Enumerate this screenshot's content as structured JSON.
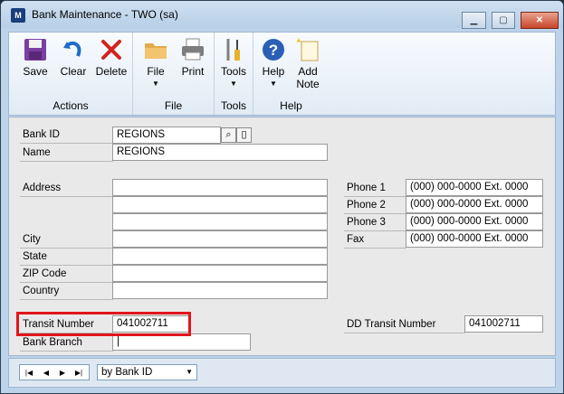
{
  "window": {
    "title": "Bank Maintenance  -  TWO (sa)",
    "app_icon_text": "M"
  },
  "ribbon": {
    "groups": [
      {
        "name": "Actions",
        "buttons": [
          "Save",
          "Clear",
          "Delete"
        ]
      },
      {
        "name": "File",
        "buttons": [
          "File",
          "Print"
        ]
      },
      {
        "name": "Tools",
        "buttons": [
          "Tools"
        ]
      },
      {
        "name": "Help",
        "buttons": [
          "Help",
          "Add Note"
        ]
      }
    ],
    "save": "Save",
    "clear": "Clear",
    "delete": "Delete",
    "file": "File",
    "print": "Print",
    "tools": "Tools",
    "help": "Help",
    "add_note_line1": "Add",
    "add_note_line2": "Note",
    "group_actions": "Actions",
    "group_file": "File",
    "group_tools": "Tools",
    "group_help": "Help"
  },
  "form": {
    "bank_id_label": "Bank ID",
    "bank_id_value": "REGIONS",
    "name_label": "Name",
    "name_value": "REGIONS",
    "address_label": "Address",
    "address_lines": [
      "",
      "",
      ""
    ],
    "city_label": "City",
    "city_value": "",
    "state_label": "State",
    "state_value": "",
    "zip_label": "ZIP Code",
    "zip_value": "",
    "country_label": "Country",
    "country_value": "",
    "phone1_label": "Phone 1",
    "phone1_value": "(000) 000-0000  Ext. 0000",
    "phone2_label": "Phone 2",
    "phone2_value": "(000) 000-0000  Ext. 0000",
    "phone3_label": "Phone 3",
    "phone3_value": "(000) 000-0000  Ext. 0000",
    "fax_label": "Fax",
    "fax_value": "(000) 000-0000  Ext. 0000",
    "transit_label": "Transit Number",
    "transit_value": "041002711",
    "dd_transit_label": "DD Transit Number",
    "dd_transit_value": "041002711",
    "bank_branch_label": "Bank Branch",
    "bank_branch_value": "|"
  },
  "navigation": {
    "sort_value": "by Bank ID",
    "icons": [
      "first-record-icon",
      "previous-record-icon",
      "next-record-icon",
      "last-record-icon"
    ]
  },
  "colors": {
    "highlight": "#e0161b",
    "window_frame": "#bcd3ea"
  }
}
